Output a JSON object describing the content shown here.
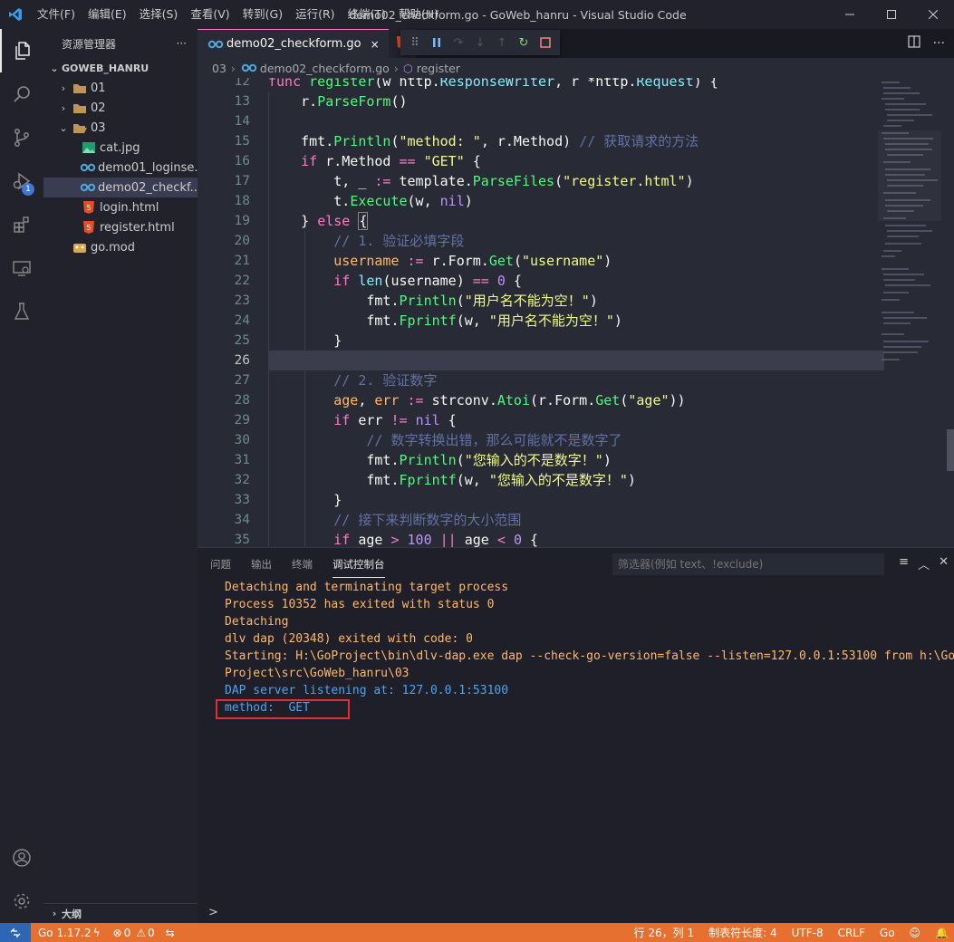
{
  "titlebar": {
    "menu": [
      "文件(F)",
      "编辑(E)",
      "选择(S)",
      "查看(V)",
      "转到(G)",
      "运行(R)",
      "终端(T)",
      "帮助(H)"
    ],
    "title": "demo02_checkform.go - GoWeb_hanru - Visual Studio Code"
  },
  "activity_bar": {
    "debug_badge": "1"
  },
  "sidebar": {
    "header": "资源管理器",
    "more": "···",
    "section": "GOWEB_HANRU",
    "items": [
      {
        "label": "01",
        "type": "folder"
      },
      {
        "label": "02",
        "type": "folder"
      },
      {
        "label": "03",
        "type": "folder-open"
      },
      {
        "label": "cat.jpg",
        "type": "image"
      },
      {
        "label": "demo01_loginse...",
        "type": "go"
      },
      {
        "label": "demo02_checkf...",
        "type": "go"
      },
      {
        "label": "login.html",
        "type": "html"
      },
      {
        "label": "register.html",
        "type": "html"
      },
      {
        "label": "go.mod",
        "type": "gomod"
      }
    ],
    "outline": "大纲"
  },
  "tabs": {
    "active": "demo02_checkform.go",
    "close": "×"
  },
  "breadcrumb": {
    "folder": "03",
    "file": "demo02_checkform.go",
    "symbol": "register"
  },
  "editor": {
    "line_numbers": [
      "12",
      "13",
      "14",
      "15",
      "16",
      "17",
      "18",
      "19",
      "20",
      "21",
      "22",
      "23",
      "24",
      "25",
      "26",
      "27",
      "28",
      "29",
      "30",
      "31",
      "32",
      "33",
      "34",
      "35"
    ],
    "current_line": "26"
  },
  "panel": {
    "tabs": [
      "问题",
      "输出",
      "终端",
      "调试控制台"
    ],
    "active_tab": "调试控制台",
    "filter_placeholder": "筛选器(例如 text、!exclude)",
    "console_lines": [
      "Detaching and terminating target process",
      "Process 10352 has exited with status 0",
      "Detaching",
      "dlv dap (20348) exited with code: 0",
      "Starting: H:\\GoProject\\bin\\dlv-dap.exe dap --check-go-version=false --listen=127.0.0.1:53100 from h:\\Go",
      "Project\\src\\GoWeb_hanru\\03"
    ],
    "server_line": "DAP server listening at: 127.0.0.1:53100",
    "method_line": "method:  GET",
    "prompt": ">"
  },
  "statusbar": {
    "go_version": "Go 1.17.2",
    "errors": "0",
    "warnings": "0",
    "position": "行 26，列 1",
    "indent": "制表符长度: 4",
    "encoding": "UTF-8",
    "eol": "CRLF",
    "language": "Go"
  },
  "colors": {
    "statusbar": "#e5702f",
    "accent": "#ff79c6"
  }
}
